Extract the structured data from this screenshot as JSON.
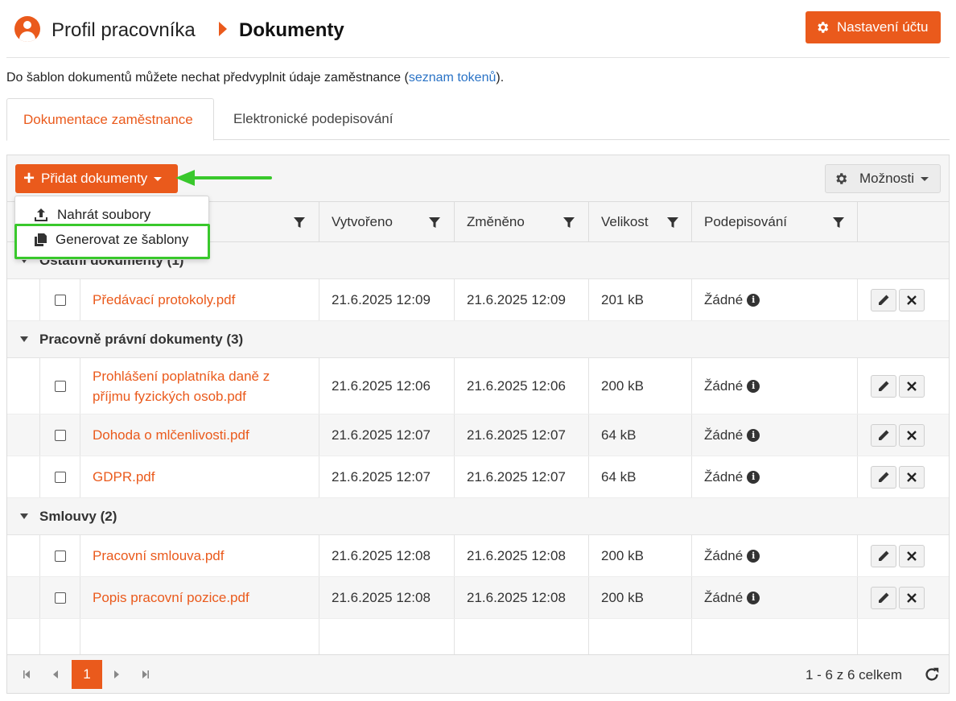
{
  "header": {
    "breadcrumb_root": "Profil pracovníka",
    "breadcrumb_current": "Dokumenty",
    "account_button": "Nastavení účtu"
  },
  "info": {
    "text_before": "Do šablon dokumentů můžete nechat předvyplnit údaje zaměstnance (",
    "link": "seznam tokenů",
    "text_after": ")."
  },
  "tabs": [
    {
      "label": "Dokumentace zaměstnance",
      "active": true
    },
    {
      "label": "Elektronické podepisování",
      "active": false
    }
  ],
  "toolbar": {
    "add_button": "Přidat dokumenty",
    "options_button": "Možnosti"
  },
  "menu": {
    "items": [
      {
        "label": "Nahrát soubory",
        "icon": "upload-icon"
      },
      {
        "label": "Generovat ze šablony",
        "icon": "copy-icon"
      }
    ]
  },
  "columns": {
    "created": "Vytvořeno",
    "modified": "Změněno",
    "size": "Velikost",
    "signing": "Podepisování"
  },
  "groups": [
    {
      "label": "Ostatní dokumenty (1)",
      "rows": [
        {
          "name": "Předávací protokoly.pdf",
          "created": "21.6.2025 12:09",
          "modified": "21.6.2025 12:09",
          "size": "201 kB",
          "signing": "Žádné"
        }
      ]
    },
    {
      "label": "Pracovně právní dokumenty (3)",
      "rows": [
        {
          "name_line1": "Prohlášení poplatníka daně z",
          "name_line2": "příjmu fyzických osob.pdf",
          "created": "21.6.2025 12:06",
          "modified": "21.6.2025 12:06",
          "size": "200 kB",
          "signing": "Žádné"
        },
        {
          "name": "Dohoda o mlčenlivosti.pdf",
          "created": "21.6.2025 12:07",
          "modified": "21.6.2025 12:07",
          "size": "64 kB",
          "signing": "Žádné"
        },
        {
          "name": "GDPR.pdf",
          "created": "21.6.2025 12:07",
          "modified": "21.6.2025 12:07",
          "size": "64 kB",
          "signing": "Žádné"
        }
      ]
    },
    {
      "label": "Smlouvy (2)",
      "rows": [
        {
          "name": "Pracovní smlouva.pdf",
          "created": "21.6.2025 12:08",
          "modified": "21.6.2025 12:08",
          "size": "200 kB",
          "signing": "Žádné"
        },
        {
          "name": "Popis pracovní pozice.pdf",
          "created": "21.6.2025 12:08",
          "modified": "21.6.2025 12:08",
          "size": "200 kB",
          "signing": "Žádné"
        }
      ]
    }
  ],
  "pager": {
    "current_page": "1",
    "summary": "1 - 6 z 6 celkem"
  },
  "colors": {
    "accent": "#ea5a1c",
    "link": "#2a73c6",
    "highlight": "#39c82c"
  }
}
